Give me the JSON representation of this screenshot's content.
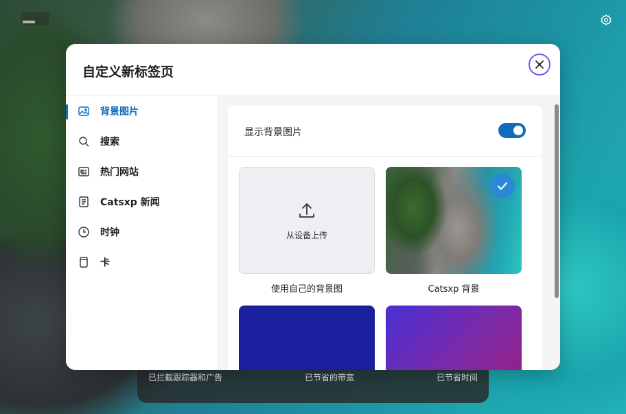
{
  "dialog": {
    "title": "自定义新标签页"
  },
  "sidebar": {
    "items": [
      {
        "label": "背景图片",
        "icon": "image-icon",
        "active": true
      },
      {
        "label": "搜索",
        "icon": "search-icon",
        "active": false
      },
      {
        "label": "热门网站",
        "icon": "top-sites-icon",
        "active": false
      },
      {
        "label": "Catsxp 新闻",
        "icon": "news-icon",
        "active": false
      },
      {
        "label": "时钟",
        "icon": "clock-icon",
        "active": false
      },
      {
        "label": "卡",
        "icon": "card-icon",
        "active": false
      }
    ]
  },
  "background": {
    "toggle_label": "显示背景图片",
    "toggle_on": true,
    "upload_text": "从设备上传",
    "upload_caption": "使用自己的背景图",
    "photo_caption": "Catsxp 背景",
    "photo_selected": true
  },
  "stats": {
    "trackers_blocked": "已拦截跟踪器和广告",
    "bandwidth_saved": "已节省的带宽",
    "time_saved": "已节省时间"
  },
  "colors": {
    "accent": "#0f6cbd",
    "close_ring": "#6b5cf6",
    "solid_tile": "#1a1f9e"
  }
}
